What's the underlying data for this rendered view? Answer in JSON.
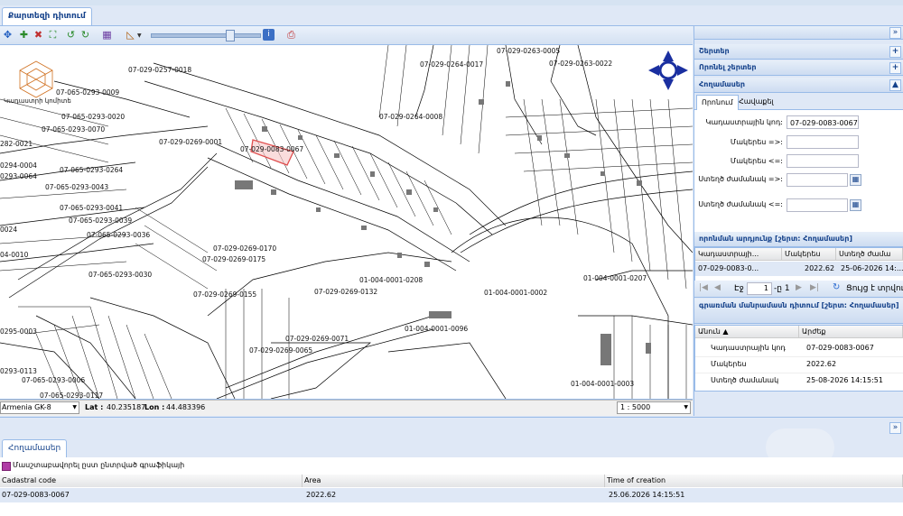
{
  "main_tab": {
    "label": "Քարտեզի դիտում"
  },
  "map": {
    "labels": [
      "07-029-0263-0005",
      "07-029-0263-0022",
      "07-029-0264-0017",
      "07-029-0264-0008",
      "07-029-0257-0018",
      "07-065-0293-0009",
      "07-065-0293-0020",
      "07-065-0293-0070",
      "07-029-0269-0001",
      "07-029-0083-0067",
      "07-065-0293-0264",
      "07-065-0293-0043",
      "07-065-0293-0041",
      "07-065-0293-0039",
      "07-065-0293-0036",
      "07-029-0269-0170",
      "07-029-0269-0175",
      "07-065-0293-0030",
      "07-029-0269-0155",
      "07-029-0269-0132",
      "01-004-0001-0208",
      "01-004-0001-0002",
      "01-004-0001-0207",
      "01-004-0001-0096",
      "07-029-0269-0071",
      "07-029-0269-0065",
      "07-065-0293-0006",
      "07-065-0293-0117",
      "01-004-0001-0003",
      "0293-0113",
      "0295-0003",
      "0024",
      "04-0010",
      "282-0021",
      "0294-0004",
      "0293-0064"
    ],
    "logo_text": "Կադաստրի կոմիտե"
  },
  "map_status": {
    "projection": "Armenia GK-8",
    "lat_label": "Lat :",
    "lat": "40.235187",
    "lon_label": "Lon :",
    "lon": "44.483396",
    "scale": "1 : 5000"
  },
  "right_panel": {
    "sections": [
      "Շերտեր",
      "Որոնել շերտեր",
      "Հողամասեր"
    ],
    "subtabs": [
      "Որոնում",
      "Հավաքել"
    ],
    "form": {
      "cadastral_label": "Կադաստրային կոդ:",
      "cadastral_value": "07-029-0083-0067",
      "area_min_label": "Մակերես =>:",
      "area_max_label": "Մակերես <=:",
      "created_from_label": "Ստեղծ ժամանակ =>:",
      "created_to_label": "Ստեղծ ժամանակ <=:"
    },
    "results": {
      "title": "որոնման արդյունք [շերտ: Հողամասեր]",
      "columns": [
        "Կադաստրայի...",
        "Մակերես",
        "Ստեղծ ժամա"
      ],
      "row": [
        "07-029-0083-0...",
        "2022.62",
        "25-06-2026 14:..."
      ],
      "pager": {
        "page_label": "Էջ",
        "page": "1",
        "of": "-ը 1",
        "refresh": "Ցույց է տրվում"
      }
    },
    "attributes": {
      "title": "գրառման մանրամասն դիտում [շերտ: Հողամասեր]",
      "columns": [
        "Անուն ▲",
        "Արժեք"
      ],
      "rows": [
        [
          "Կադաստրային կոդ",
          "07-029-0083-0067"
        ],
        [
          "Մակերես",
          "2022.62"
        ],
        [
          "Ստեղծ ժամանակ",
          "25-08-2026 14:15:51"
        ]
      ]
    }
  },
  "bottom": {
    "tab": "Հողամասեր",
    "checkbox_label": "Մասշտաբավորել ըստ ընտրված գրաֆիկայի",
    "columns": [
      "Cadastral code",
      "Area",
      "Time of creation"
    ],
    "row": [
      "07-029-0083-0067",
      "2022.62",
      "25.06.2026 14:15:51"
    ]
  },
  "colors": {
    "accent": "#15428b",
    "highlight": "#e05050",
    "north_arrow": "#1a2fa0"
  }
}
